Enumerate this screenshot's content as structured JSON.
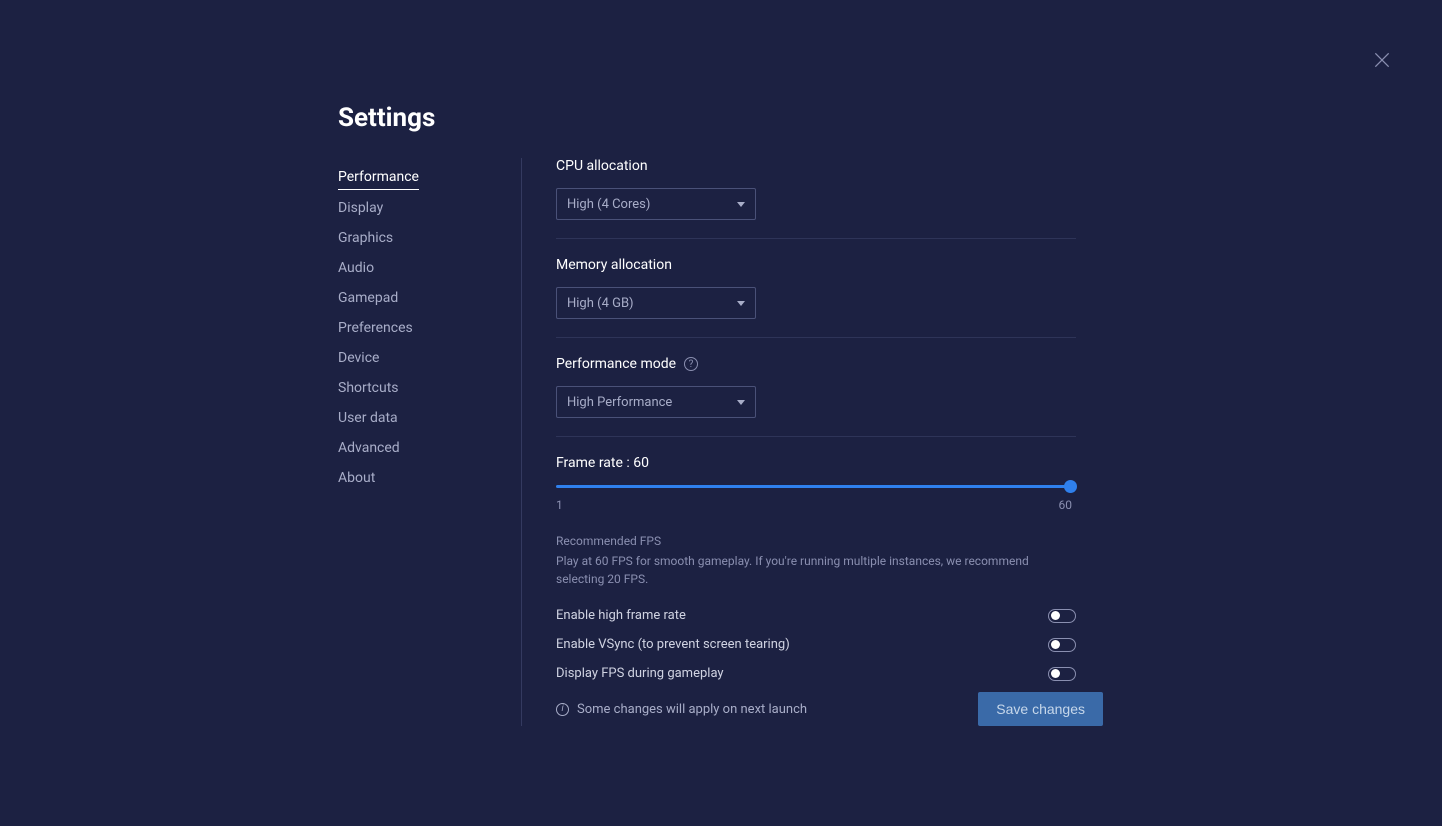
{
  "title": "Settings",
  "sidebar": {
    "items": [
      {
        "label": "Performance",
        "active": true
      },
      {
        "label": "Display"
      },
      {
        "label": "Graphics"
      },
      {
        "label": "Audio"
      },
      {
        "label": "Gamepad"
      },
      {
        "label": "Preferences"
      },
      {
        "label": "Device"
      },
      {
        "label": "Shortcuts"
      },
      {
        "label": "User data"
      },
      {
        "label": "Advanced"
      },
      {
        "label": "About"
      }
    ]
  },
  "cpu": {
    "label": "CPU allocation",
    "value": "High (4 Cores)"
  },
  "memory": {
    "label": "Memory allocation",
    "value": "High (4 GB)"
  },
  "perfmode": {
    "label": "Performance mode",
    "value": "High Performance"
  },
  "framerate": {
    "label": "Frame rate : 60",
    "min": "1",
    "max": "60",
    "rec_title": "Recommended FPS",
    "rec_text": "Play at 60 FPS for smooth gameplay. If you're running multiple instances, we recommend selecting 20 FPS."
  },
  "toggles": {
    "high_fps": "Enable high frame rate",
    "vsync": "Enable VSync (to prevent screen tearing)",
    "display_fps": "Display FPS during gameplay"
  },
  "footer": {
    "note": "Some changes will apply on next launch",
    "save": "Save changes"
  }
}
